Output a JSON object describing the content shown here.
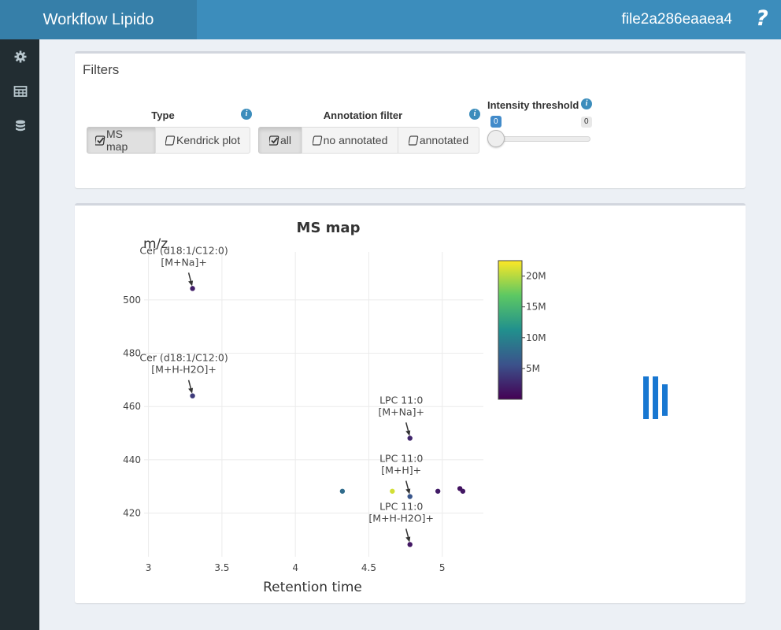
{
  "header": {
    "app_title": "Workflow Lipido",
    "project_name": "file2a286eaaea4",
    "help_label": "?",
    "brand_color": "#367fa9",
    "bar_color": "#3c8dbc"
  },
  "sidebar": {
    "items": [
      {
        "icon": "gear-icon"
      },
      {
        "icon": "table-icon"
      },
      {
        "icon": "database-icon"
      }
    ]
  },
  "filters": {
    "title": "Filters",
    "type": {
      "label": "Type",
      "options": [
        "MS map",
        "Kendrick plot"
      ],
      "selected": "MS map"
    },
    "annotation": {
      "label": "Annotation filter",
      "options": [
        "all",
        "no annotated",
        "annotated"
      ],
      "selected": "all"
    },
    "intensity": {
      "label": "Intensity threshold",
      "min_label": "0",
      "max_label": "0",
      "value": 0
    }
  },
  "chart_data": {
    "type": "scatter",
    "title": "MS map",
    "xlabel": "Retention time",
    "ylabel": "m/z",
    "xlim": [
      2.97,
      5.28
    ],
    "ylim": [
      403.6,
      518.0
    ],
    "xticks": [
      "3",
      "3.5",
      "4",
      "4.5",
      "5"
    ],
    "yticks": [
      "420",
      "440",
      "460",
      "480",
      "500"
    ],
    "grid": true,
    "colorbar": {
      "ticks": [
        "5M",
        "10M",
        "15M",
        "20M"
      ],
      "range": [
        0,
        22500000
      ],
      "colors": [
        "#440154",
        "#3b528b",
        "#21908d",
        "#5dc863",
        "#fde725"
      ]
    },
    "points": [
      {
        "x": 3.3,
        "y": 504.3,
        "intensity": 2000000
      },
      {
        "x": 3.3,
        "y": 464.0,
        "intensity": 4000000
      },
      {
        "x": 4.32,
        "y": 428.2,
        "intensity": 8000000
      },
      {
        "x": 4.66,
        "y": 428.2,
        "intensity": 21000000
      },
      {
        "x": 4.78,
        "y": 448.1,
        "intensity": 2500000
      },
      {
        "x": 4.78,
        "y": 426.2,
        "intensity": 6000000
      },
      {
        "x": 4.78,
        "y": 408.2,
        "intensity": 1500000
      },
      {
        "x": 4.97,
        "y": 428.2,
        "intensity": 1800000
      },
      {
        "x": 5.12,
        "y": 429.2,
        "intensity": 1200000
      },
      {
        "x": 5.14,
        "y": 428.2,
        "intensity": 1500000
      }
    ],
    "annotations": [
      {
        "line1": "Cer (d18:1/C12:0)",
        "line2": "[M+Na]+",
        "x": 3.3,
        "y": 504.3
      },
      {
        "line1": "Cer (d18:1/C12:0)",
        "line2": "[M+H-H2O]+",
        "x": 3.3,
        "y": 464.0
      },
      {
        "line1": "LPC 11:0",
        "line2": "[M+Na]+",
        "x": 4.78,
        "y": 448.1
      },
      {
        "line1": "LPC 11:0",
        "line2": "[M+H]+",
        "x": 4.78,
        "y": 426.2
      },
      {
        "line1": "LPC 11:0",
        "line2": "[M+H-H2O]+",
        "x": 4.78,
        "y": 408.2
      }
    ]
  }
}
